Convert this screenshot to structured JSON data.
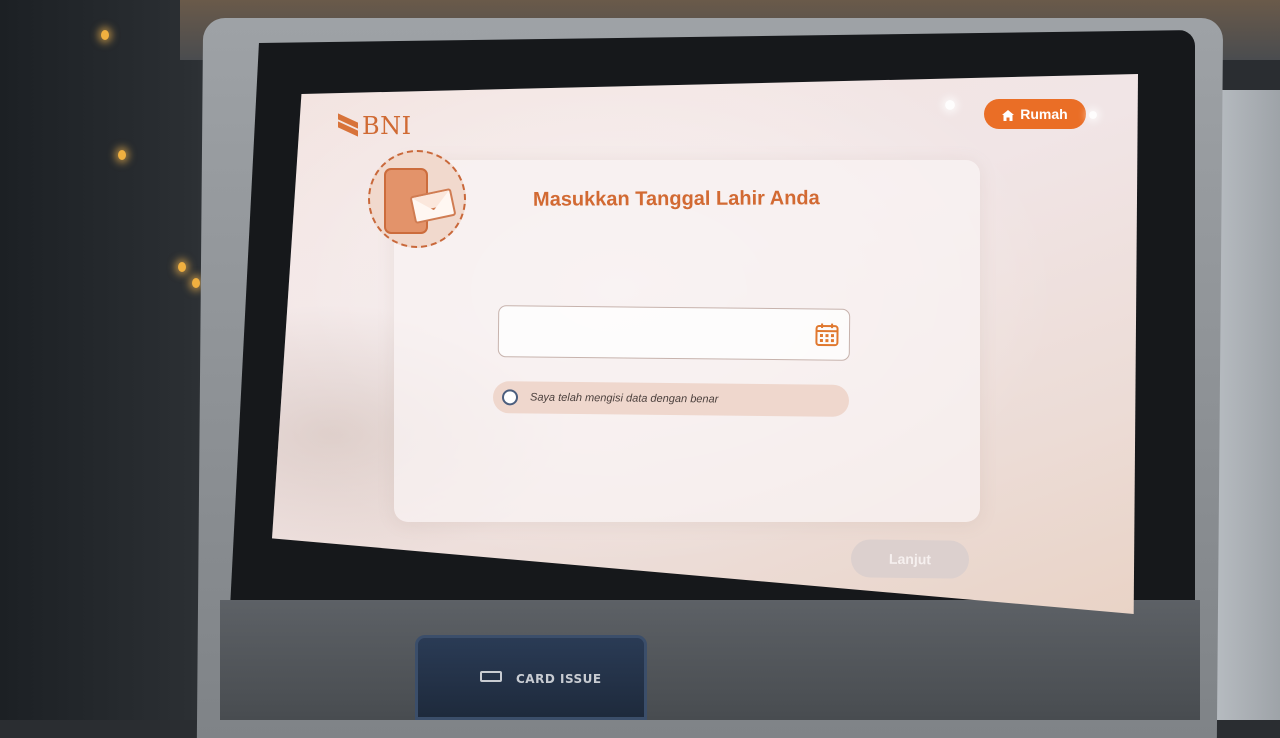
{
  "brand": {
    "logo_text": "BNI",
    "accent_color": "#ea6e26",
    "title_color": "#d26a33"
  },
  "header": {
    "home_button_label": "Rumah",
    "home_icon": "home-icon"
  },
  "form": {
    "title": "Masukkan Tanggal Lahir Anda",
    "date_input": {
      "value": "",
      "icon": "calendar-icon"
    },
    "confirmation": {
      "label": "Saya telah mengisi data dengan benar",
      "checked": false
    }
  },
  "footer": {
    "next_button_label": "Lanjut",
    "next_button_enabled": false
  },
  "hardware": {
    "card_slot_label": "CARD ISSUE"
  }
}
